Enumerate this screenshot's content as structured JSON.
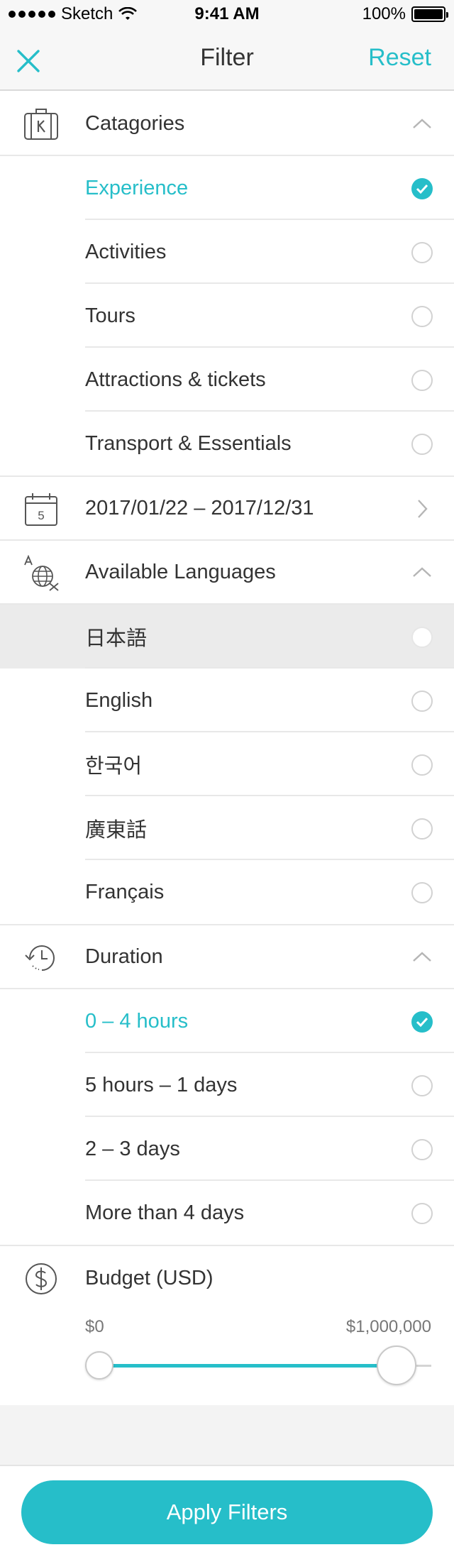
{
  "status_bar": {
    "carrier": "Sketch",
    "time": "9:41 AM",
    "battery": "100%"
  },
  "nav": {
    "title": "Filter",
    "reset_label": "Reset"
  },
  "colors": {
    "accent": "#26bec9",
    "text": "#333333",
    "divider": "#e8e8e8",
    "highlight": "#ebebeb"
  },
  "categories": {
    "title": "Catagories",
    "icon": "luggage-k-icon",
    "items": [
      {
        "label": "Experience",
        "selected": true
      },
      {
        "label": "Activities",
        "selected": false
      },
      {
        "label": "Tours",
        "selected": false
      },
      {
        "label": "Attractions & tickets",
        "selected": false
      },
      {
        "label": "Transport & Essentials",
        "selected": false
      }
    ]
  },
  "date": {
    "label": "2017/01/22 – 2017/12/31",
    "icon": "calendar-icon",
    "calendar_day": "5"
  },
  "languages": {
    "title": "Available Languages",
    "icon": "translate-globe-icon",
    "items": [
      {
        "label": "日本語",
        "selected": false,
        "highlighted": true
      },
      {
        "label": "English",
        "selected": false
      },
      {
        "label": "한국어",
        "selected": false
      },
      {
        "label": "廣東話",
        "selected": false
      },
      {
        "label": "Français",
        "selected": false
      }
    ]
  },
  "duration": {
    "title": "Duration",
    "icon": "history-clock-icon",
    "items": [
      {
        "label": "0 – 4 hours",
        "selected": true
      },
      {
        "label": "5 hours – 1 days",
        "selected": false
      },
      {
        "label": "2 – 3 days",
        "selected": false
      },
      {
        "label": "More than 4 days",
        "selected": false
      }
    ]
  },
  "budget": {
    "title": "Budget (USD)",
    "icon": "dollar-circle-icon",
    "min_label": "$0",
    "max_label": "$1,000,000",
    "range_fraction": [
      0.0,
      0.9
    ]
  },
  "apply_label": "Apply Filters"
}
